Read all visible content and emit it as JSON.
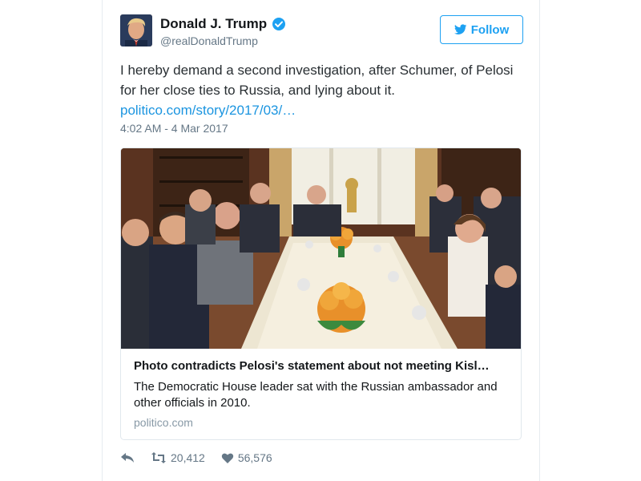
{
  "author": {
    "name": "Donald J. Trump",
    "handle": "@realDonaldTrump",
    "verified_icon": "verified-badge-icon",
    "avatar_icon": "profile-avatar"
  },
  "follow_button": {
    "label": "Follow",
    "icon": "twitter-bird-icon"
  },
  "tweet": {
    "text": "I hereby demand a second investigation, after Schumer, of Pelosi for her close ties to Russia, and lying about it.",
    "link": "politico.com/story/2017/03/…",
    "timestamp": "4:02 AM - 4 Mar 2017"
  },
  "card": {
    "title": "Photo contradicts Pelosi's statement about not meeting Kisl…",
    "description": "The Democratic House leader sat with the Russian ambassador and other officials in 2010.",
    "domain": "politico.com"
  },
  "actions": {
    "reply_icon": "reply-icon",
    "retweet_icon": "retweet-icon",
    "retweet_count": "20,412",
    "like_icon": "heart-icon",
    "like_count": "56,576"
  },
  "colors": {
    "accent": "#1da1f2",
    "link": "#1b95e0",
    "muted": "#657786",
    "text": "#14171a"
  }
}
